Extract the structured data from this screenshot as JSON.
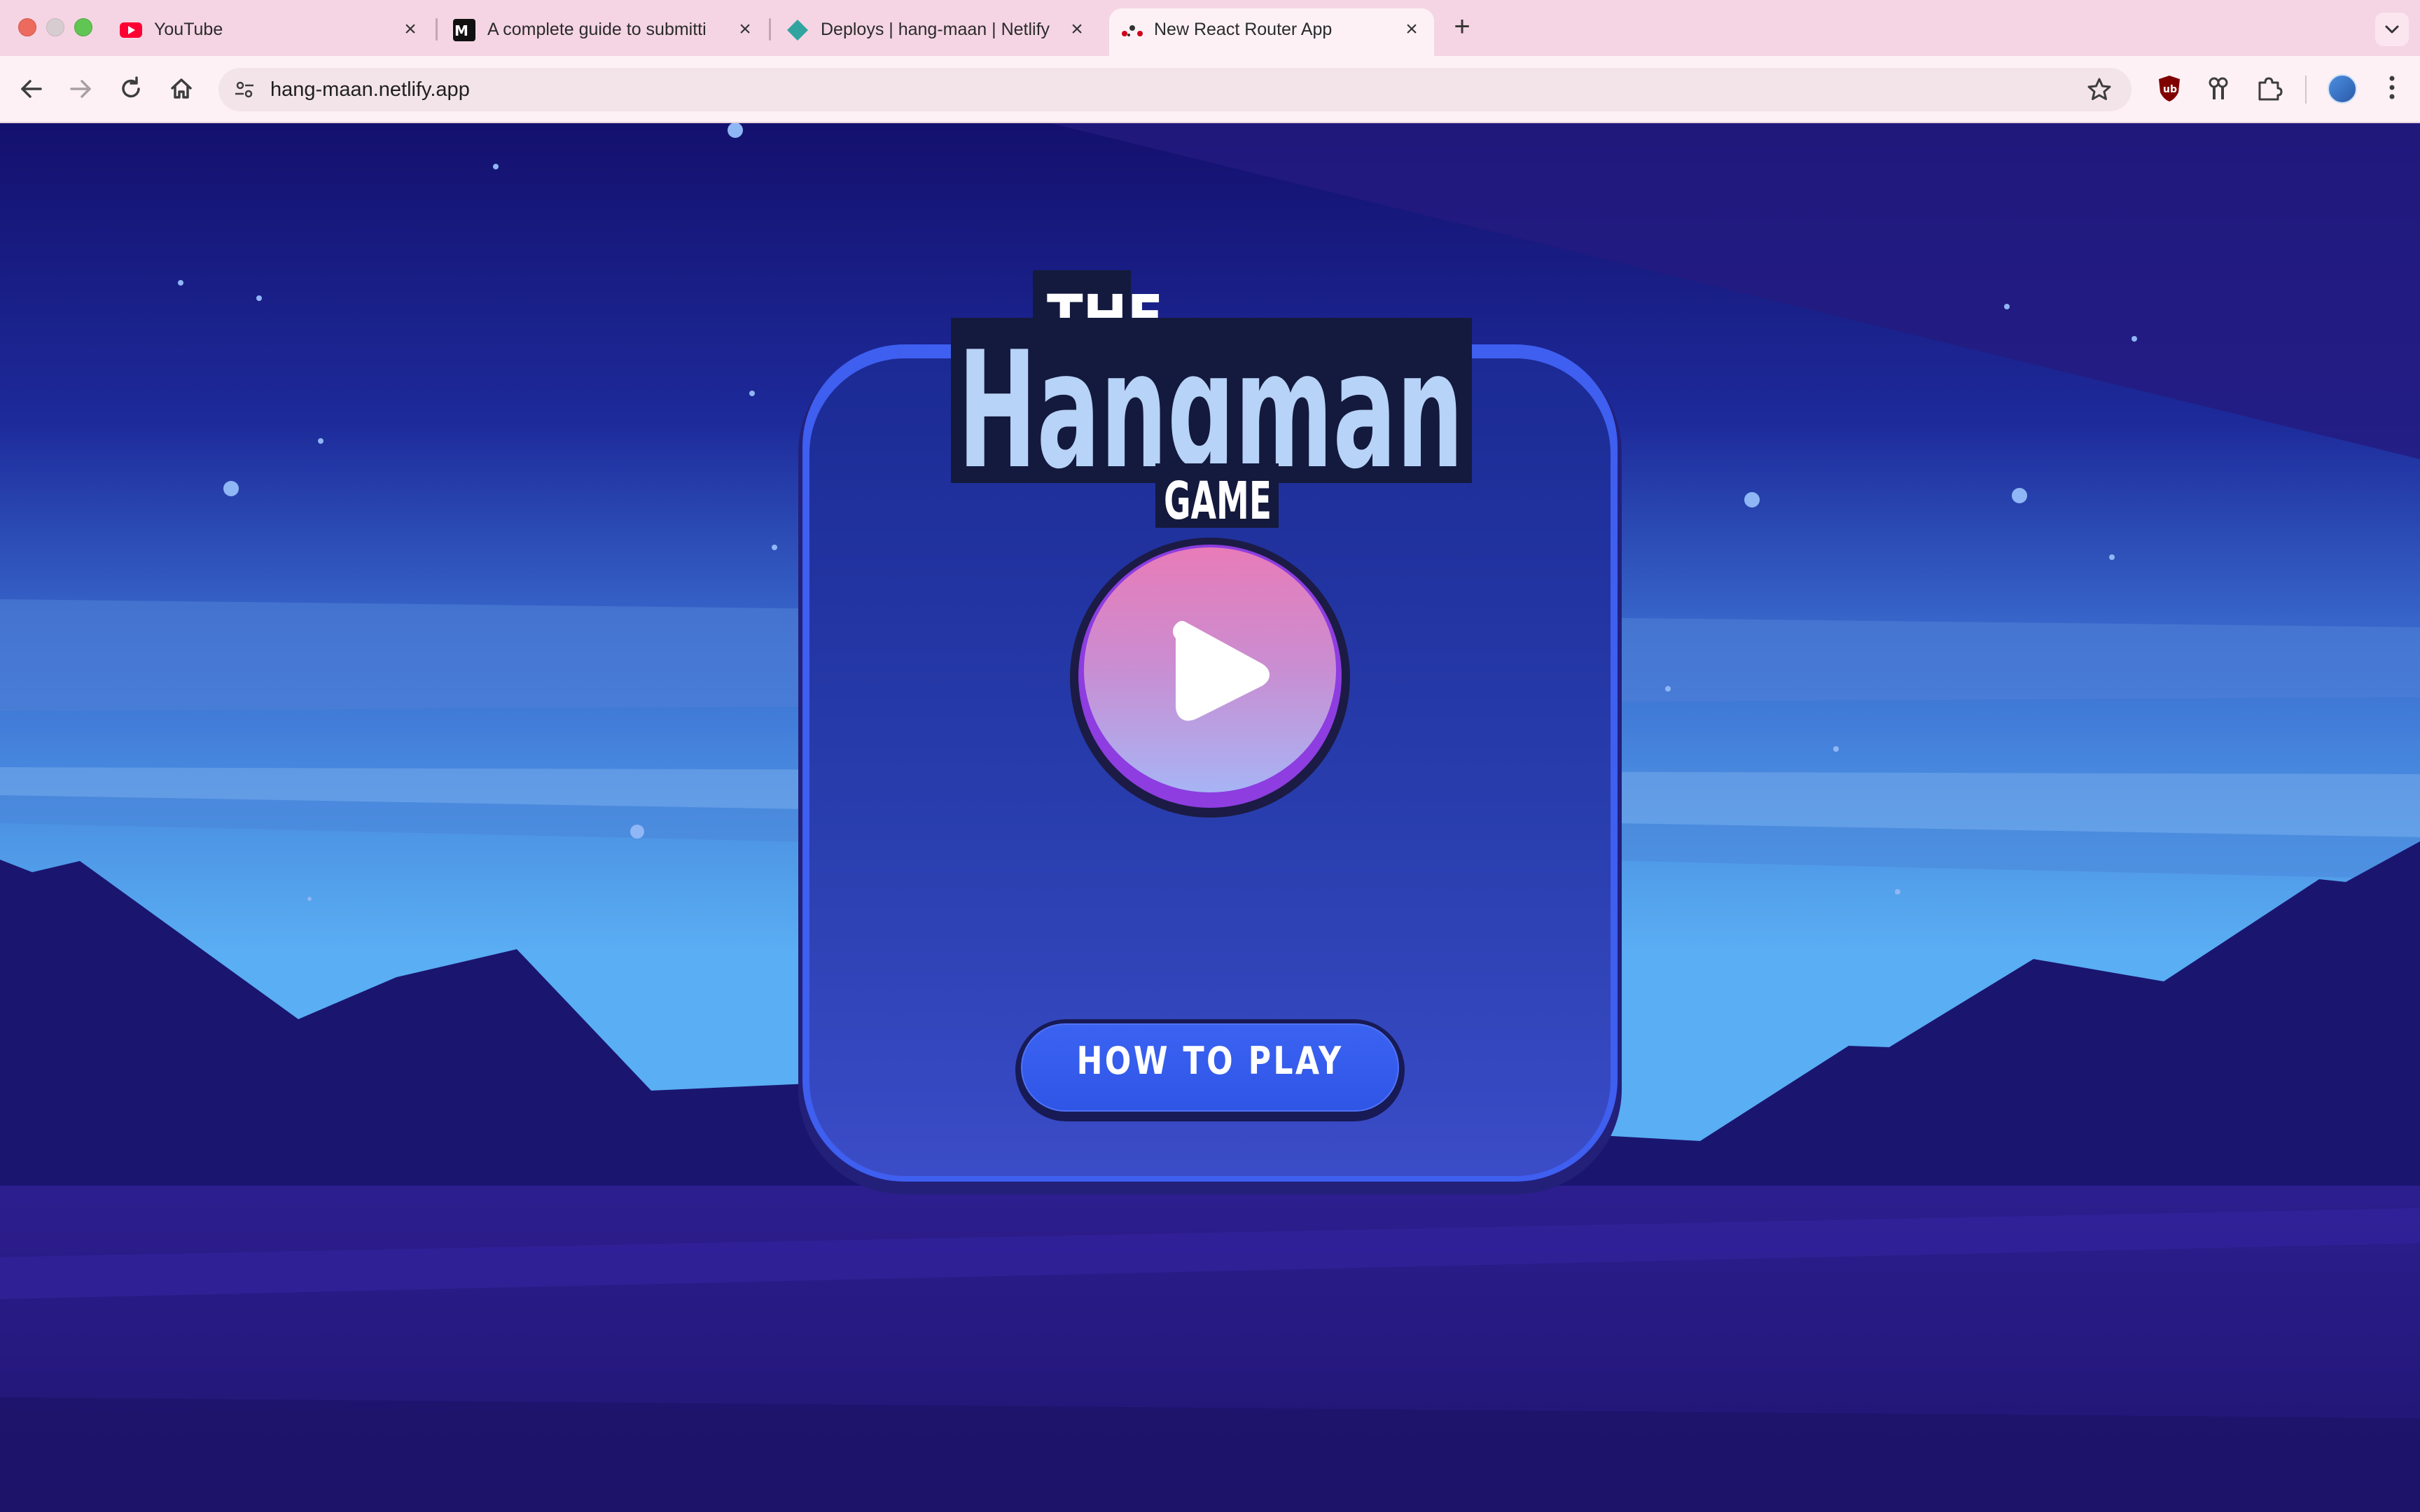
{
  "browser": {
    "tabs": [
      {
        "title": "YouTube",
        "favicon": "youtube-icon",
        "active": false
      },
      {
        "title": "A complete guide to submitti",
        "favicon": "medium-icon",
        "active": false
      },
      {
        "title": "Deploys | hang-maan | Netlify",
        "favicon": "netlify-icon",
        "active": false
      },
      {
        "title": "New React Router App",
        "favicon": "react-router-icon",
        "active": true
      }
    ],
    "url": "hang-maan.netlify.app",
    "extensions": [
      "ublock-icon",
      "extension-key-icon",
      "puzzle-icon"
    ]
  },
  "game": {
    "logo": {
      "line1": "THE",
      "line2": "Hangman",
      "line3": "GAME"
    },
    "play_button": "play-icon",
    "how_to_play_label": "HOW TO PLAY"
  },
  "colors": {
    "sky_top": "#14106e",
    "sky_horizon": "#5aaef3",
    "mountains": "#1a1670",
    "ground": "#2a1a85",
    "card_border": "#3e5ff0",
    "play_gradient_top": "#e87bb8",
    "play_gradient_bottom": "#a7b4f5",
    "button_blue": "#3b63f2"
  }
}
